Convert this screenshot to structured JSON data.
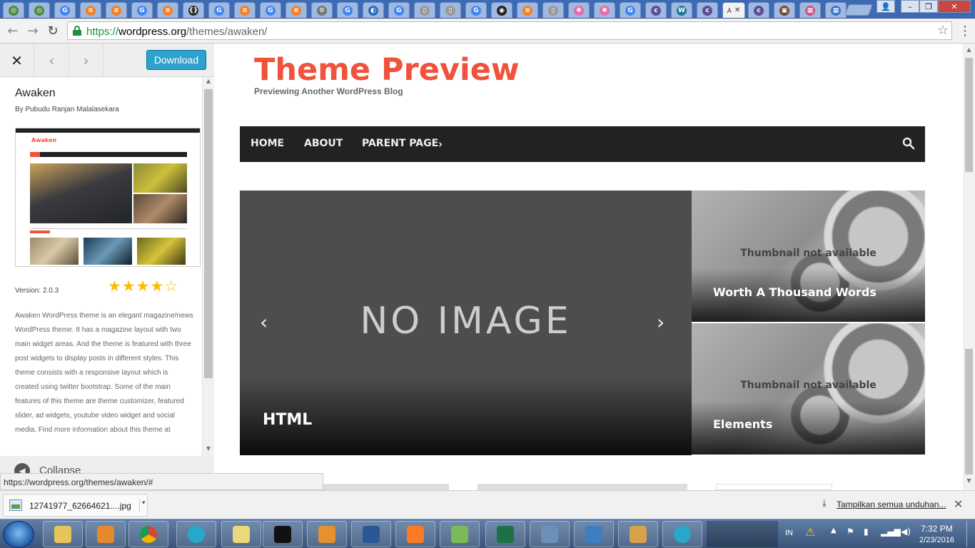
{
  "browser": {
    "url_scheme": "https://",
    "url_host": "wordpress.org",
    "url_path": "/themes/awaken/",
    "active_tab_label": "A"
  },
  "panel": {
    "download_label": "Download",
    "theme_name": "Awaken",
    "author": "By Pubudu Ranjan Malalasekara",
    "version": "Version: 2.0.3",
    "stars": "★★★★☆",
    "description": "Awaken WordPress theme is an elegant magazine/news WordPress theme. It has a magazine layout with two main widget areas. And the theme is featured with three post widgets to display posts in different styles. This theme consists with a responsive layout which is created using twitter bootstrap. Some of the main features of this theme are theme customizer, featured slider, ad widgets, youtube video widget and social media. Find more information about this theme at",
    "collapse_label": "Collapse",
    "screenshot_title": "Awaken"
  },
  "site": {
    "title": "Theme Preview",
    "tagline": "Previewing Another WordPress Blog",
    "menu": [
      "HOME",
      "ABOUT",
      "PARENT PAGE"
    ],
    "slide_placeholder": "NO IMAGE",
    "slide_title": "HTML",
    "thumbs": [
      {
        "placeholder": "Thumbnail not available",
        "title": "Worth A Thousand Words"
      },
      {
        "placeholder": "Thumbnail not available",
        "title": "Elements"
      }
    ]
  },
  "status_url": "https://wordpress.org/themes/awaken/#",
  "downloads": {
    "file_name": "12741977_62664621....jpg",
    "show_all_label": "Tampilkan semua unduhan..."
  },
  "taskbar": {
    "language": "IN",
    "time": "7:32 PM",
    "date": "2/23/2016"
  },
  "colors": {
    "site_title": "#f0523b",
    "menu_bg": "#222222",
    "download_button": "#2ea2cc",
    "star": "#ffb900"
  }
}
